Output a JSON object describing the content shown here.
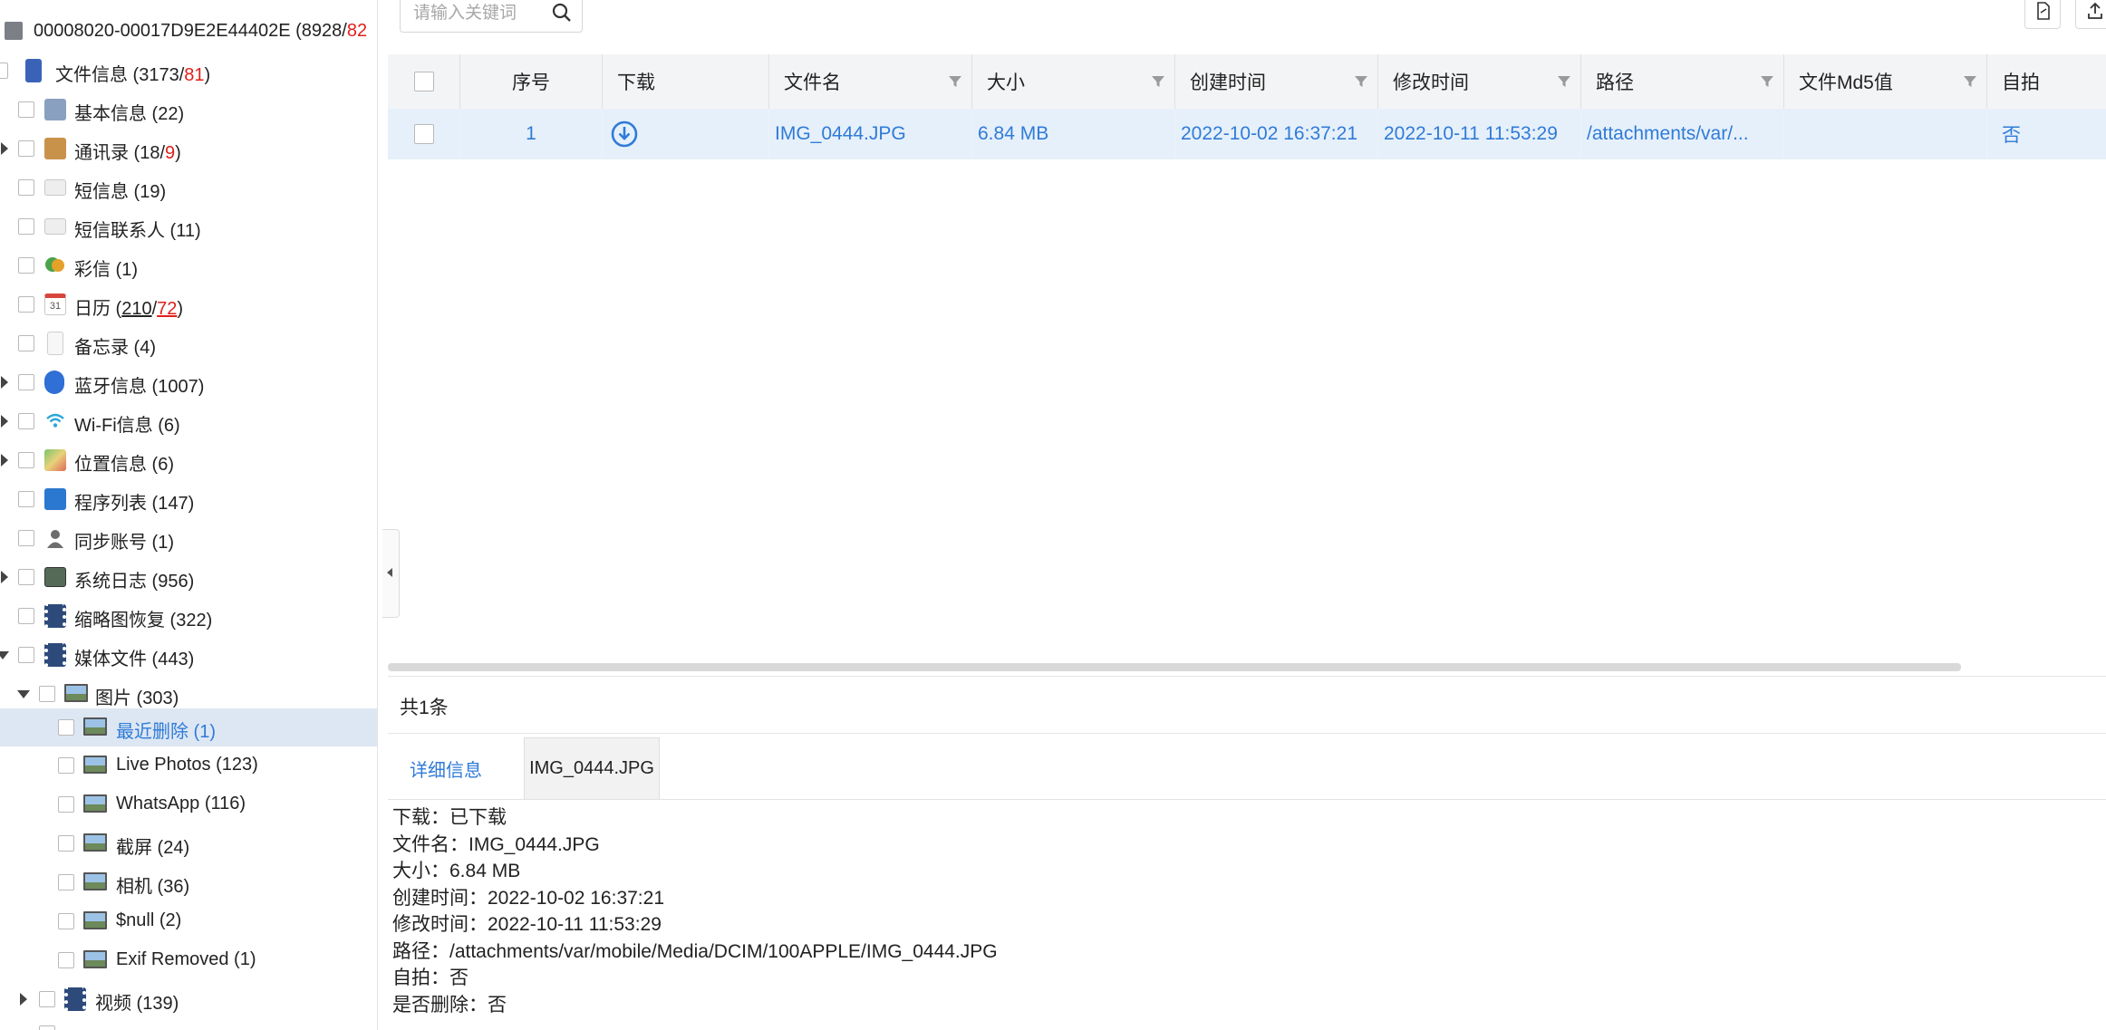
{
  "sidebar": {
    "device": {
      "name": "00008020-00017D9E2E44402E (8928/",
      "red": "82"
    },
    "file_info": {
      "label": "文件信息 (3173/",
      "red": "81",
      "end": ")"
    },
    "items": [
      {
        "label": "基本信息 (22)",
        "icon": "info-icon"
      },
      {
        "label": "通讯录 (18/",
        "red": "9",
        "end": ")",
        "icon": "contacts-icon"
      },
      {
        "label": "短信息 (19)",
        "icon": "mail-icon"
      },
      {
        "label": "短信联系人 (11)",
        "icon": "mail-icon"
      },
      {
        "label": "彩信 (1)",
        "icon": "chat-bubbles-icon"
      },
      {
        "label": "日历 (",
        "u1": "210",
        "sep": "/",
        "u2": "72",
        "end": ")",
        "icon": "calendar-icon",
        "calendar_day": "31"
      },
      {
        "label": "备忘录 (4)",
        "icon": "note-icon"
      },
      {
        "label": "蓝牙信息 (1007)",
        "icon": "bluetooth-icon"
      },
      {
        "label": "Wi-Fi信息 (6)",
        "icon": "wifi-icon"
      },
      {
        "label": "位置信息 (6)",
        "icon": "map-icon"
      },
      {
        "label": "程序列表 (147)",
        "icon": "app-list-icon"
      },
      {
        "label": "同步账号 (1)",
        "icon": "user-icon"
      },
      {
        "label": "系统日志 (956)",
        "icon": "log-icon"
      },
      {
        "label": "缩略图恢复 (322)",
        "icon": "film-icon"
      },
      {
        "label": "媒体文件 (443)",
        "icon": "film-icon"
      },
      {
        "label": "图片 (303)",
        "icon": "image-icon"
      },
      {
        "label": "最近删除 (1)",
        "icon": "image-icon"
      },
      {
        "label": "Live Photos (123)",
        "icon": "image-icon"
      },
      {
        "label": "WhatsApp (116)",
        "icon": "image-icon"
      },
      {
        "label": "截屏 (24)",
        "icon": "image-icon"
      },
      {
        "label": "相机 (36)",
        "icon": "image-icon"
      },
      {
        "label": "$null (2)",
        "icon": "image-icon"
      },
      {
        "label": "Exif Removed (1)",
        "icon": "image-icon"
      },
      {
        "label": "视频 (139)",
        "icon": "video-icon"
      }
    ]
  },
  "search": {
    "placeholder": "请输入关键词"
  },
  "table": {
    "columns": [
      "序号",
      "下载",
      "文件名",
      "大小",
      "创建时间",
      "修改时间",
      "路径",
      "文件Md5值",
      "自拍"
    ],
    "rows": [
      {
        "index": "1",
        "file_name": "IMG_0444.JPG",
        "size": "6.84 MB",
        "created": "2022-10-02 16:37:21",
        "modified": "2022-10-11 11:53:29",
        "path": "/attachments/var/...",
        "md5": "",
        "selfie": "否"
      }
    ]
  },
  "total": "共1条",
  "tabs": [
    "详细信息",
    "IMG_0444.JPG"
  ],
  "detail": {
    "download": "下载：已下载",
    "file_name": "文件名：IMG_0444.JPG",
    "size": "大小：6.84 MB",
    "created": "创建时间：2022-10-02 16:37:21",
    "modified": "修改时间：2022-10-11 11:53:29",
    "path": "路径：/attachments/var/mobile/Media/DCIM/100APPLE/IMG_0444.JPG",
    "selfie": "自拍：否",
    "deleted": "是否删除：否"
  },
  "colors": {
    "accent": "#2f7bd8",
    "count_red": "#e0201a",
    "selected_row": "#e6f0fa"
  }
}
